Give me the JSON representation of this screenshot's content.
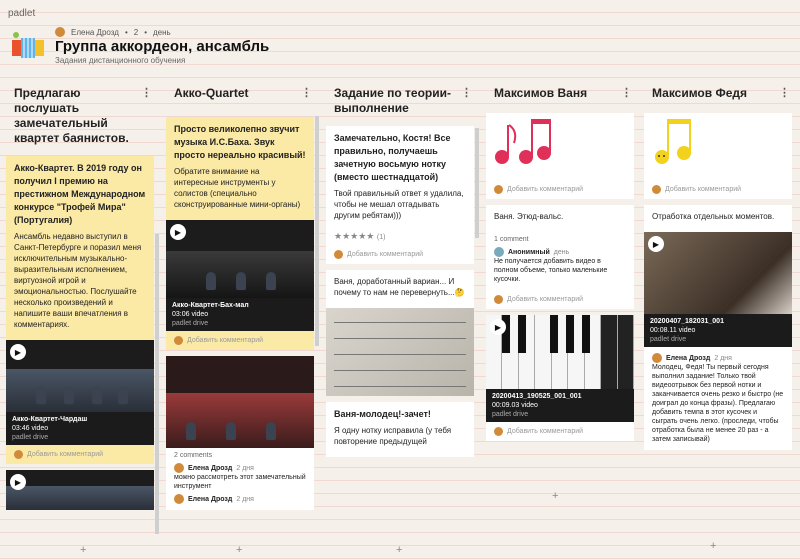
{
  "app": {
    "brand": "padlet"
  },
  "header": {
    "author": "Елена Дрозд",
    "count": "2",
    "age": "день",
    "title": "Группа аккордеон, ансамбль",
    "subtitle": "Задания дистанционного обучения"
  },
  "columns": [
    {
      "title": "Предлагаю послушать замечательный квартет баянистов.",
      "card1": {
        "heading": "Акко-Квартет. В 2019 году он получил I премию на престижном Международном конкурсе \"Трофей Мира\" (Португалия)",
        "body": "Ансамбль недавно выступил в Санкт-Петербурге и поразил меня исключительным музыкально-выразительным исполнением, виртуозной игрой и эмоциональностью. Послушайте несколько произведений и напишите ваши впечатления в комментариях.",
        "video_title": "Акко-Квартет-Чардаш",
        "video_meta": "03:46 video",
        "video_source": "padlet drive",
        "add_comment": "Добавить комментарий"
      }
    },
    {
      "title": "Акко-Quartet",
      "card1": {
        "heading": "Просто великолепно звучит музыка И.С.Баха. Звук просто нереально красивый!",
        "body": "Обратите внимание на интересные инструменты у солистов (специально сконструированные мини-органы)",
        "video_title": "Акко-Квартет-Бах-мал",
        "video_meta": "03:06 video",
        "video_source": "padlet drive",
        "add_comment": "Добавить комментарий"
      },
      "card2": {
        "comments_count": "2 comments",
        "comment_author": "Елена Дрозд",
        "comment_age": "2 дня",
        "comment_text": "можно рассмотреть этот замечательный инструмент",
        "comment2_author": "Елена Дрозд",
        "comment2_age": "2 дня"
      }
    },
    {
      "title": "Задание по теории-выполнение",
      "card1": {
        "heading": "Замечательно, Костя! Все правильно, получаешь зачетную восьмую нотку (вместо шестнадцатой)",
        "body": "Твой правильный ответ я удалила, чтобы не мешал отгадывать другим ребятам)))",
        "stars": "★★★★★",
        "stars_count": "(1)",
        "add_comment": "Добавить комментарий"
      },
      "card2": {
        "body": "Ваня, доработанный вариан... И почему то нам не перевернуть...🤔"
      },
      "card3": {
        "heading": "Ваня-молодец!-зачет!",
        "body": "Я одну нотку исправила (у тебя повторение предыдущей"
      }
    },
    {
      "title": "Максимов Ваня",
      "card1": {
        "add_comment": "Добавить комментарий"
      },
      "card2": {
        "body": "Ваня. Этюд-вальс.",
        "comments_count": "1 comment",
        "comment_author": "Анонимный",
        "comment_age": "день",
        "comment_text": "Не получается добавить видео в полном объеме, только маленькие кусочки.",
        "add_comment": "Добавить комментарий"
      },
      "card3": {
        "video_title": "20200413_190525_001_001",
        "video_meta": "00:09.03 video",
        "video_source": "padlet drive",
        "add_comment": "Добавить комментарий"
      }
    },
    {
      "title": "Максимов Федя",
      "card1": {
        "add_comment": "Добавить комментарий"
      },
      "card2": {
        "body": "Отработка отдельных моментов.",
        "video_title": "20200407_182031_001",
        "video_meta": "00:08.11 video",
        "video_source": "padlet drive",
        "comment_author": "Елена Дрозд",
        "comment_age": "2 дня",
        "comment_text": "Молодец, Федя! Ты первый сегодня выполнил задание! Только твой видеоотрывок без первой нотки и заканчивается очень резко и быстро (не доиграл до конца фразы). Предлагаю добавить темпа в этот кусочек и сыграть очень легко. (проследи, чтобы отработка была не менее 20 раз - а затем записывай)"
      }
    }
  ],
  "icons": {
    "menu": "⋮",
    "plus": "+",
    "play": "▶"
  }
}
